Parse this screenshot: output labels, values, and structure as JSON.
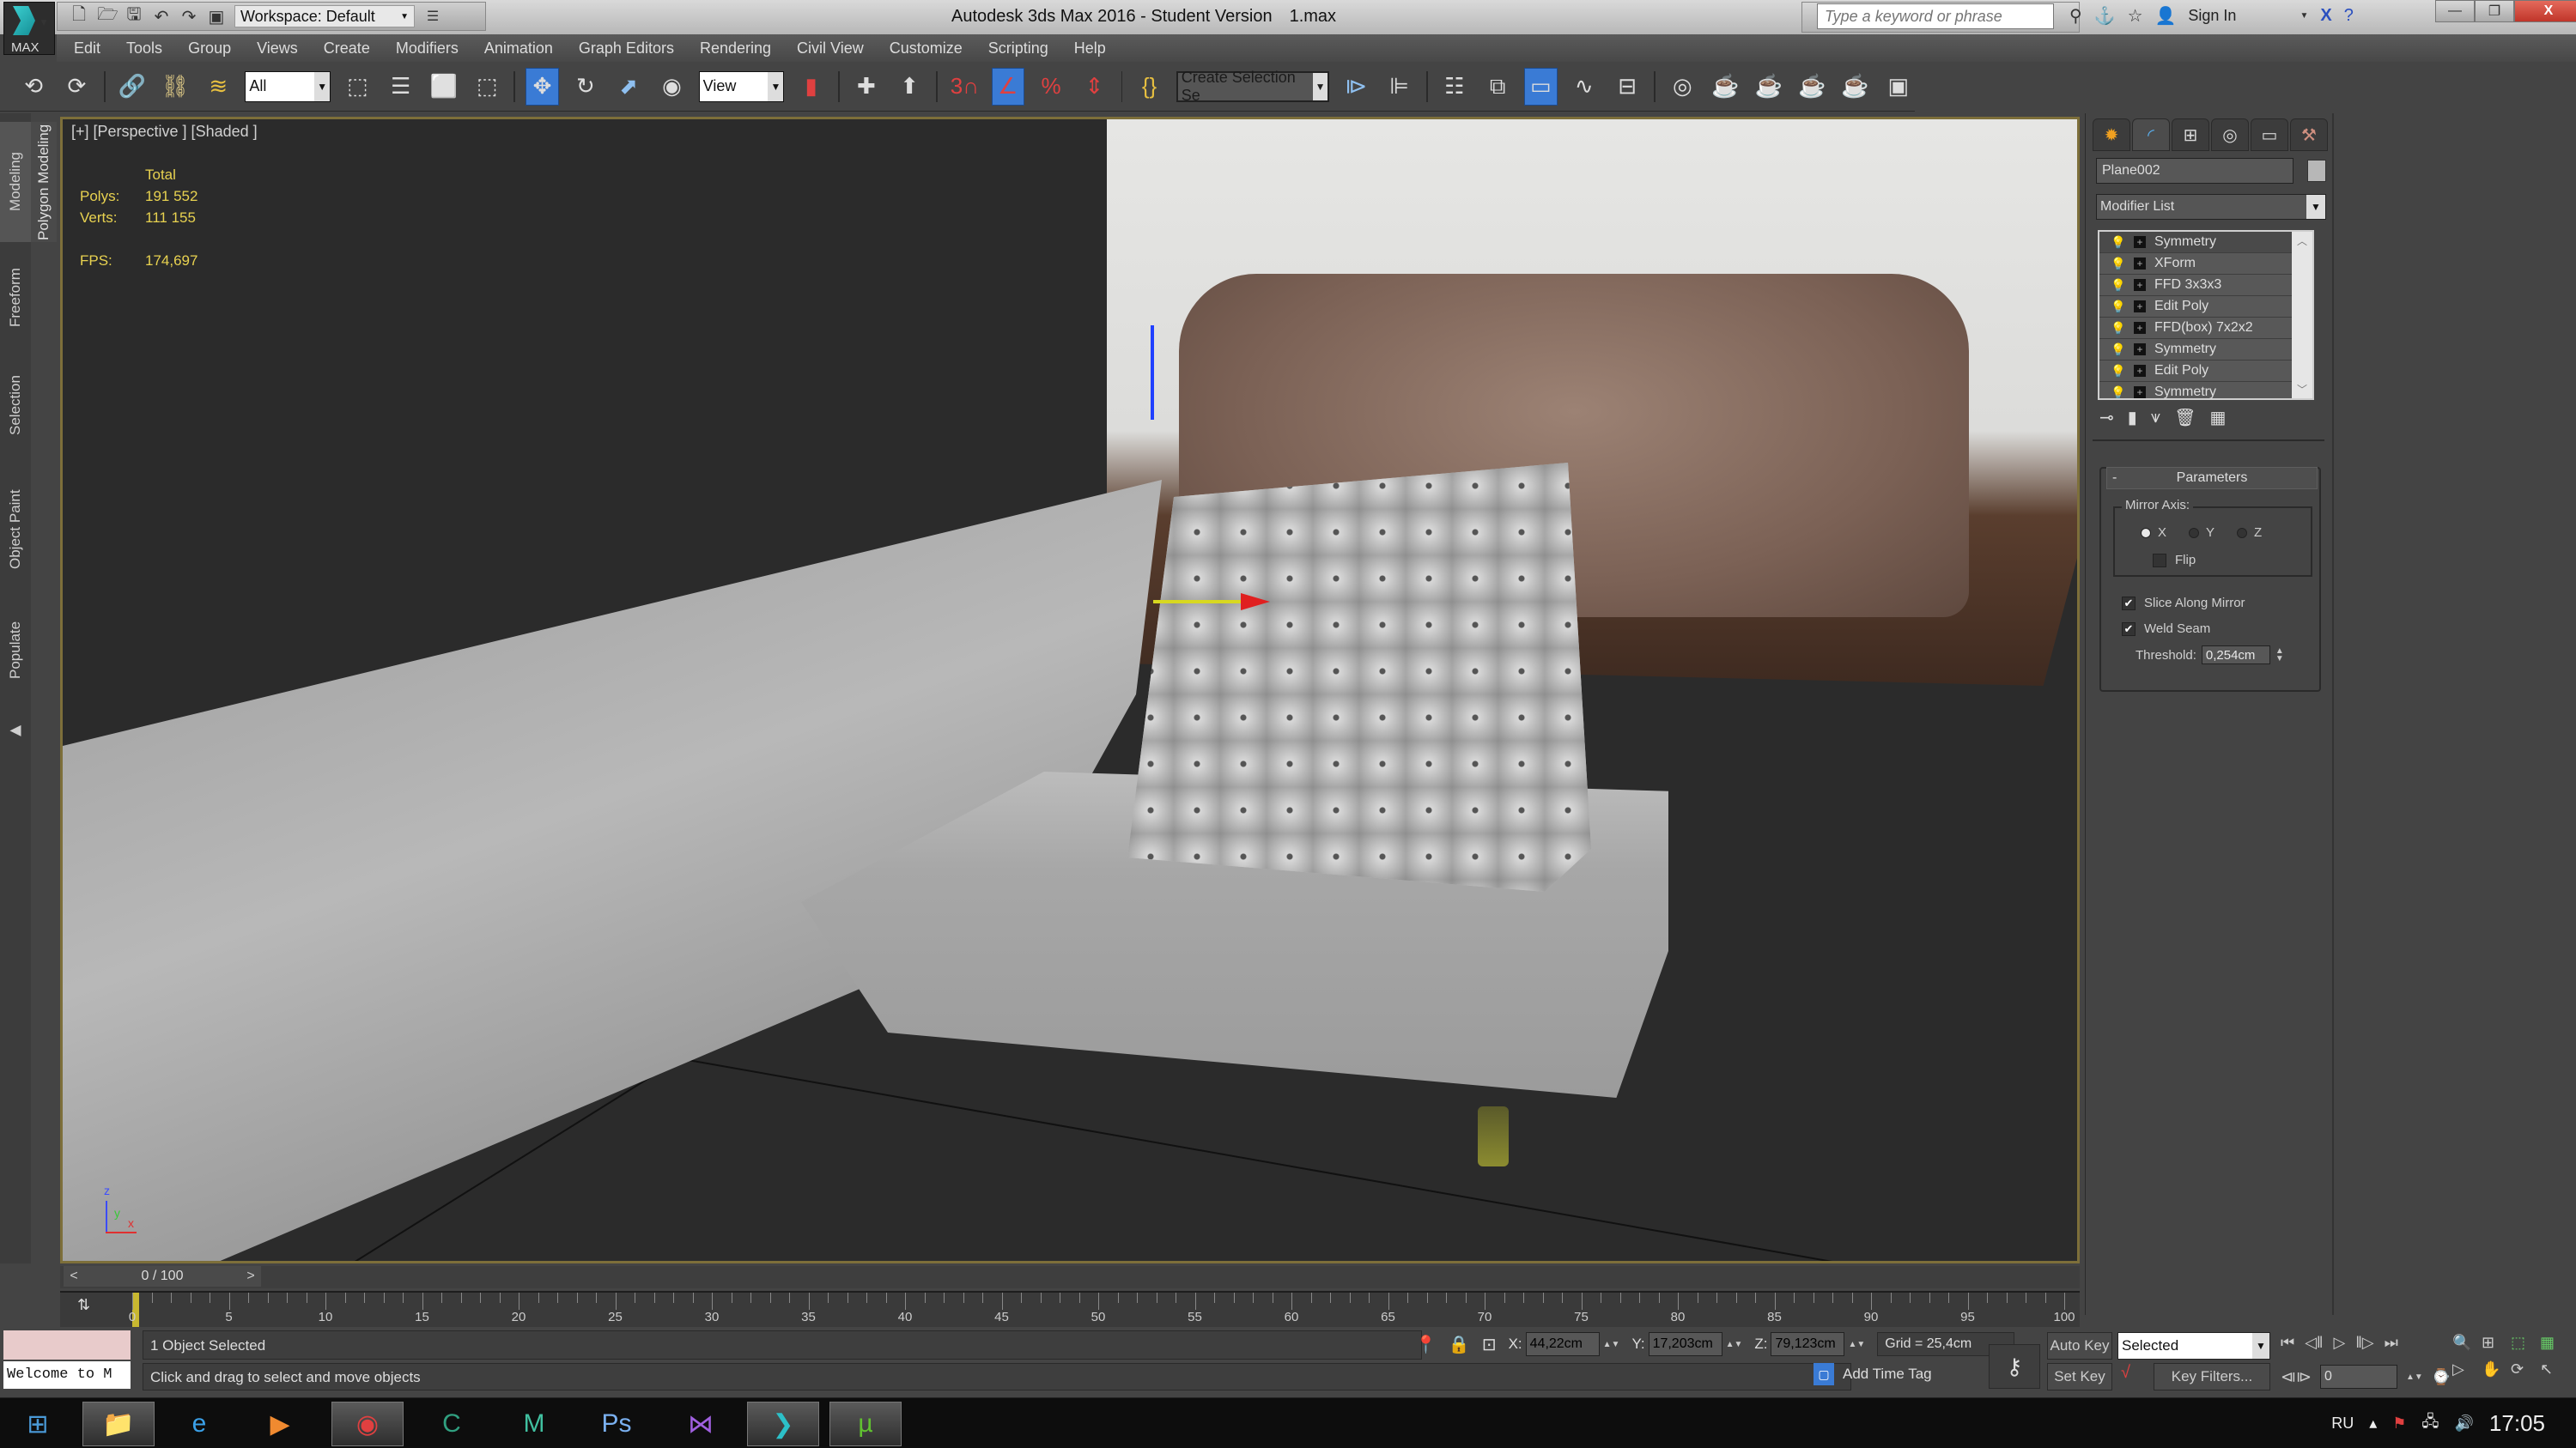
{
  "titlebar": {
    "logo_label": "MAX",
    "workspace": "Workspace: Default",
    "app_title": "Autodesk 3ds Max 2016 - Student Version",
    "file_name": "1.max",
    "search_placeholder": "Type a keyword or phrase",
    "sign_in": "Sign In"
  },
  "menu": [
    "Edit",
    "Tools",
    "Group",
    "Views",
    "Create",
    "Modifiers",
    "Animation",
    "Graph Editors",
    "Rendering",
    "Civil View",
    "Customize",
    "Scripting",
    "Help"
  ],
  "toolbar": {
    "selection_filter": "All",
    "ref_coord": "View",
    "selection_set_placeholder": "Create Selection Se",
    "active_tool": "select-and-move"
  },
  "ribbon": {
    "tabs": [
      "Modeling",
      "Freeform",
      "Selection",
      "Object Paint",
      "Populate"
    ],
    "active_panel": "Polygon Modeling"
  },
  "viewport": {
    "label": "[+] [Perspective ] [Shaded ]",
    "stats": {
      "header": "Total",
      "polys_label": "Polys:",
      "polys": "191 552",
      "verts_label": "Verts:",
      "verts": "111 155",
      "fps_label": "FPS:",
      "fps": "174,697"
    },
    "axis": {
      "z": "z",
      "y": "y",
      "x": "x"
    }
  },
  "command_panel": {
    "object_name": "Plane002",
    "modifier_list": "Modifier List",
    "stack": [
      "Symmetry",
      "XForm",
      "FFD 3x3x3",
      "Edit Poly",
      "FFD(box) 7x2x2",
      "Symmetry",
      "Edit Poly",
      "Symmetry"
    ],
    "rollout_title": "Parameters",
    "mirror_axis_label": "Mirror Axis:",
    "axes": [
      {
        "label": "X",
        "selected": true
      },
      {
        "label": "Y",
        "selected": false
      },
      {
        "label": "Z",
        "selected": false
      }
    ],
    "flip_label": "Flip",
    "flip_checked": false,
    "slice_label": "Slice Along Mirror",
    "slice_checked": true,
    "weld_label": "Weld Seam",
    "weld_checked": true,
    "threshold_label": "Threshold:",
    "threshold_value": "0,254cm"
  },
  "timeline": {
    "frame_display": "0 / 100",
    "current_frame": 0,
    "total_frames": 100,
    "ruler_labels": [
      "0",
      "5",
      "10",
      "15",
      "20",
      "25",
      "30",
      "35",
      "40",
      "45",
      "50",
      "55",
      "60",
      "65",
      "70",
      "75",
      "80",
      "85",
      "90",
      "95",
      "100"
    ]
  },
  "status": {
    "welcome": "Welcome to M",
    "selection": "1 Object Selected",
    "prompt": "Click and drag to select and move objects",
    "x_label": "X:",
    "x": "44,22cm",
    "y_label": "Y:",
    "y": "17,203cm",
    "z_label": "Z:",
    "z": "79,123cm",
    "grid": "Grid = 25,4cm",
    "add_time_tag": "Add Time Tag",
    "auto_key": "Auto Key",
    "set_key": "Set Key",
    "key_mode": "Selected",
    "key_filters": "Key Filters...",
    "frame": "0"
  },
  "taskbar": {
    "apps": [
      "start",
      "explorer",
      "internet-explorer",
      "media-player",
      "chrome",
      "camtasia",
      "mudbox",
      "photoshop",
      "visual-studio",
      "3ds-max",
      "utorrent"
    ],
    "lang": "RU",
    "time": "17:05"
  }
}
